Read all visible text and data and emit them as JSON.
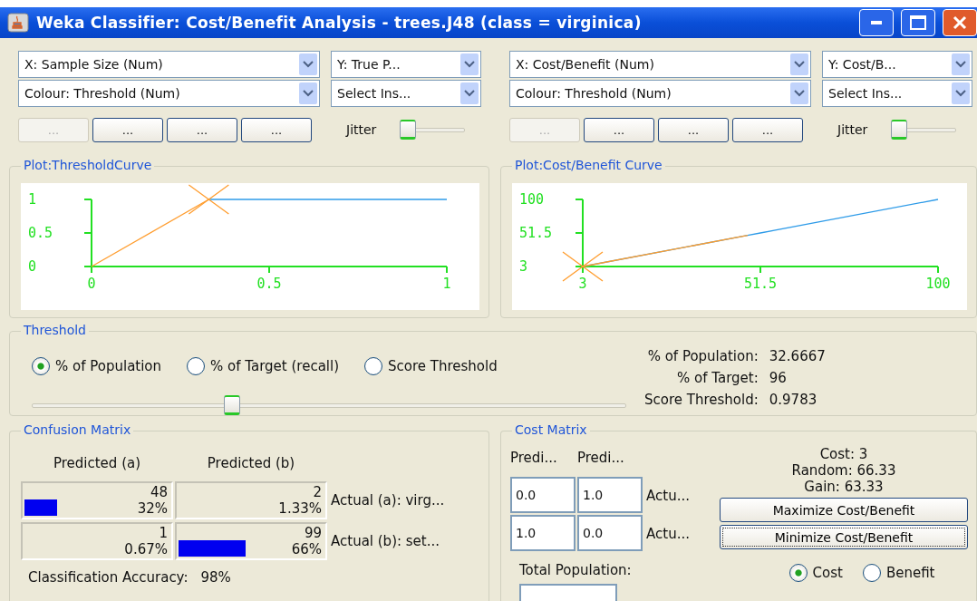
{
  "window": {
    "title": "Weka Classifier: Cost/Benefit Analysis - trees.J48 (class = virginica)"
  },
  "panels": [
    {
      "combos": [
        {
          "value": "X: Sample Size (Num)"
        },
        {
          "value": "Y: True P..."
        },
        {
          "value": "Colour: Threshold (Num)"
        },
        {
          "value": "Select Ins..."
        }
      ],
      "buttons": [
        {
          "label": "...",
          "disabled": true
        },
        {
          "label": "...",
          "disabled": false
        },
        {
          "label": "...",
          "disabled": false
        },
        {
          "label": "...",
          "disabled": false
        }
      ],
      "jitter": {
        "label": "Jitter",
        "level": 0
      },
      "plot": {
        "title": "Plot:ThresholdCurve",
        "chart_data": {
          "type": "line",
          "x": [
            0,
            0.33,
            0.67,
            1
          ],
          "xlim": [
            0,
            1
          ],
          "ylim": [
            0,
            1
          ],
          "xticks": [
            0,
            0.5,
            1
          ],
          "yticks": [
            0,
            0.5,
            1
          ],
          "series": [
            {
              "color": "#2e9be8",
              "values": [
                null,
                1,
                1,
                1
              ]
            },
            {
              "color": "#ff9d2e",
              "values": [
                0,
                1,
                null,
                null
              ]
            }
          ]
        },
        "marker_at_end": true
      }
    },
    {
      "combos": [
        {
          "value": "X: Cost/Benefit (Num)"
        },
        {
          "value": "Y: Cost/B..."
        },
        {
          "value": "Colour: Threshold (Num)"
        },
        {
          "value": "Select Ins..."
        }
      ],
      "buttons": [
        {
          "label": "...",
          "disabled": true
        },
        {
          "label": "...",
          "disabled": false
        },
        {
          "label": "...",
          "disabled": false
        },
        {
          "label": "...",
          "disabled": false
        }
      ],
      "jitter": {
        "label": "Jitter",
        "level": 0
      },
      "plot": {
        "title": "Plot:Cost/Benefit Curve",
        "chart_data": {
          "type": "line",
          "x": [
            3,
            48,
            51.5,
            100
          ],
          "xlim": [
            3,
            100
          ],
          "ylim": [
            3,
            100
          ],
          "xticks": [
            3,
            51.5,
            100
          ],
          "yticks": [
            3,
            51.5,
            100
          ],
          "series": [
            {
              "color": "#2e9be8",
              "values": [
                3,
                48,
                51.5,
                100
              ]
            },
            {
              "color": "#ff9d2e",
              "values": [
                3,
                48,
                null,
                null
              ]
            }
          ]
        },
        "marker_at_end": false
      }
    }
  ],
  "threshold": {
    "title": "Threshold",
    "options": [
      {
        "label": "% of Population",
        "selected": true
      },
      {
        "label": "% of Target (recall)",
        "selected": false
      },
      {
        "label": "Score Threshold",
        "selected": false
      }
    ],
    "slider": {
      "level": 0.3267
    },
    "stats": [
      {
        "label": "% of Population:",
        "value": "32.6667"
      },
      {
        "label": "% of Target:",
        "value": "96"
      },
      {
        "label": "Score Threshold:",
        "value": "0.9783"
      }
    ]
  },
  "confusion_matrix": {
    "title": "Confusion Matrix",
    "columns": [
      "Predicted (a)",
      "Predicted (b)"
    ],
    "rows": [
      {
        "label": "Actual (a): virg...",
        "cells": [
          {
            "count": "48",
            "percent": "32%",
            "level": 0.22
          },
          {
            "count": "2",
            "percent": "1.33%"
          }
        ]
      },
      {
        "label": "Actual (b):  set...",
        "cells": [
          {
            "count": "1",
            "percent": "0.67%"
          },
          {
            "count": "99",
            "percent": "66%",
            "level": 0.45
          }
        ]
      }
    ],
    "accuracy": {
      "label": "Classification Accuracy:",
      "value": "98%"
    }
  },
  "cost_matrix": {
    "title": "Cost Matrix",
    "columns": [
      "Predi...",
      "Predi..."
    ],
    "rows": [
      {
        "label": "Actu...",
        "cells": [
          "0.0",
          "1.0"
        ]
      },
      {
        "label": "Actu...",
        "cells": [
          "1.0",
          "0.0"
        ]
      }
    ],
    "total_population": {
      "label": "Total Population:"
    },
    "stats": [
      "Cost: 3",
      "Random: 66.33",
      "Gain: 63.33"
    ],
    "buttons": [
      {
        "label": "Maximize Cost/Benefit",
        "focused": false
      },
      {
        "label": "Minimize Cost/Benefit",
        "focused": true
      }
    ],
    "options": [
      {
        "label": "Cost",
        "selected": true
      },
      {
        "label": "Benefit",
        "selected": false
      }
    ]
  }
}
